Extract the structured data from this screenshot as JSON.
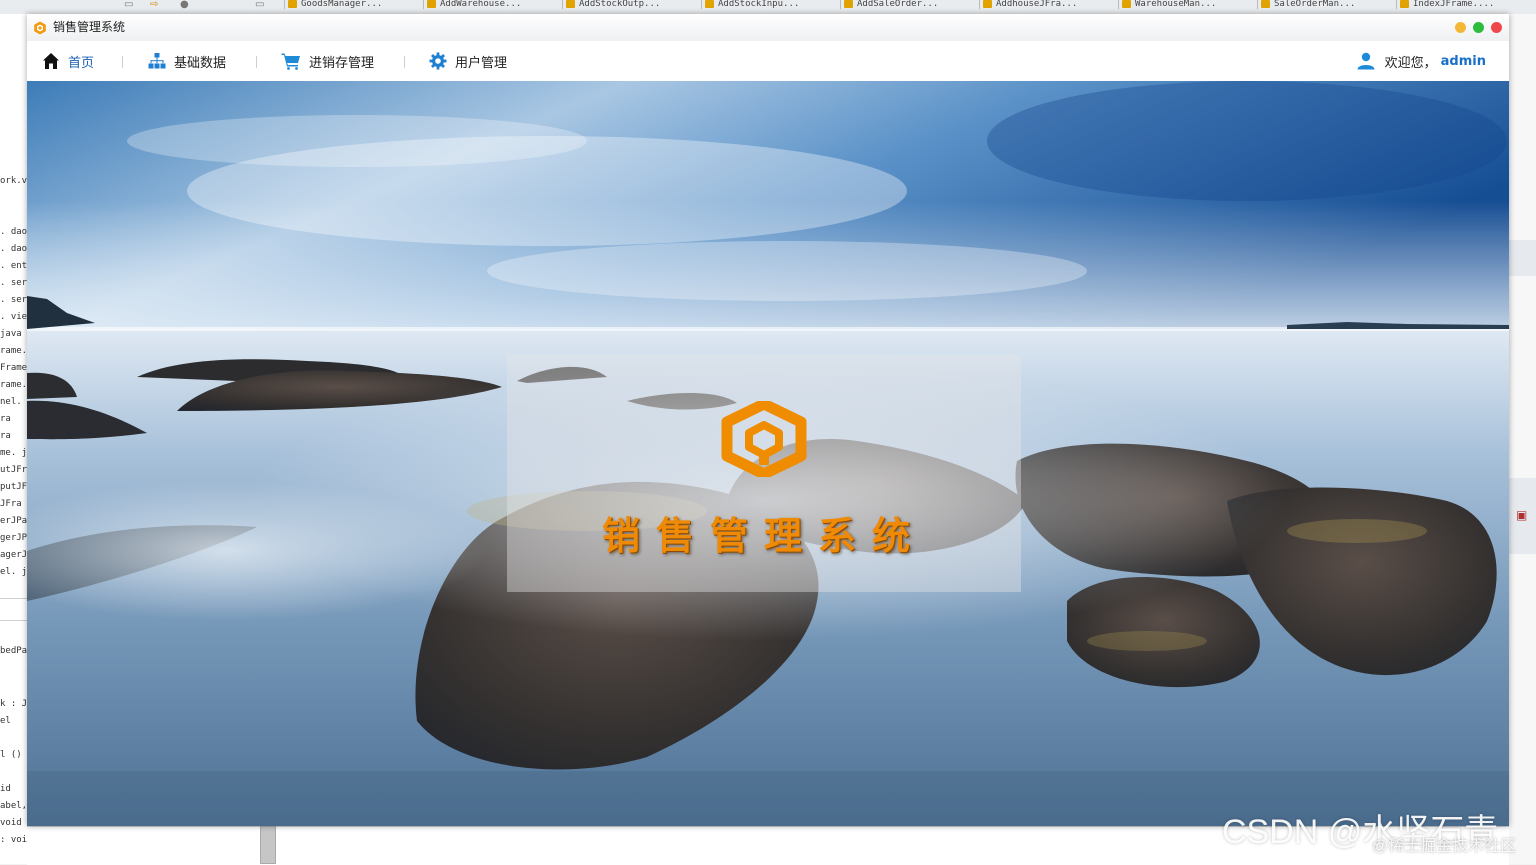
{
  "ide": {
    "tabs": [
      "GoodsManager...",
      "AddWarehouse...",
      "AddStockOutp...",
      "AddStockInpu...",
      "AddSaleOrder...",
      "AddhouseJFra...",
      "WarehouseMan...",
      "SaleOrderMan...",
      "IndexJFrame...."
    ],
    "code_lines": [
      "ork.v",
      ". dao",
      ". dao.",
      ". ent:",
      ". serv",
      ". serv",
      ". view",
      " java",
      "rame.",
      "Frame",
      "rame.",
      "nel.",
      "ra",
      "ra",
      "me. j",
      "utJFr",
      "putJF",
      "JFra",
      "erJPa",
      "gerJP",
      "agerJ",
      "el. j",
      "bedPa",
      "k : J",
      "el",
      "l ()",
      "id",
      "abel,",
      "void",
      ": void"
    ]
  },
  "window": {
    "title": "销售管理系统",
    "controls": {
      "minimize_color": "#f5b836",
      "maximize_color": "#2dbd3e",
      "close_color": "#f0474a"
    }
  },
  "navbar": {
    "items": [
      {
        "label": "首页",
        "icon": "home-icon"
      },
      {
        "label": "基础数据",
        "icon": "sitemap-icon"
      },
      {
        "label": "进销存管理",
        "icon": "cart-icon"
      },
      {
        "label": "用户管理",
        "icon": "gear-icon"
      }
    ],
    "welcome_text": "欢迎您，",
    "username": "admin"
  },
  "hero": {
    "logo_title": "销售管理系统",
    "logo_color": "#f08c00"
  },
  "watermark": {
    "main": "CSDN @水坚石青",
    "sub": "@稀土掘金技术社区"
  }
}
